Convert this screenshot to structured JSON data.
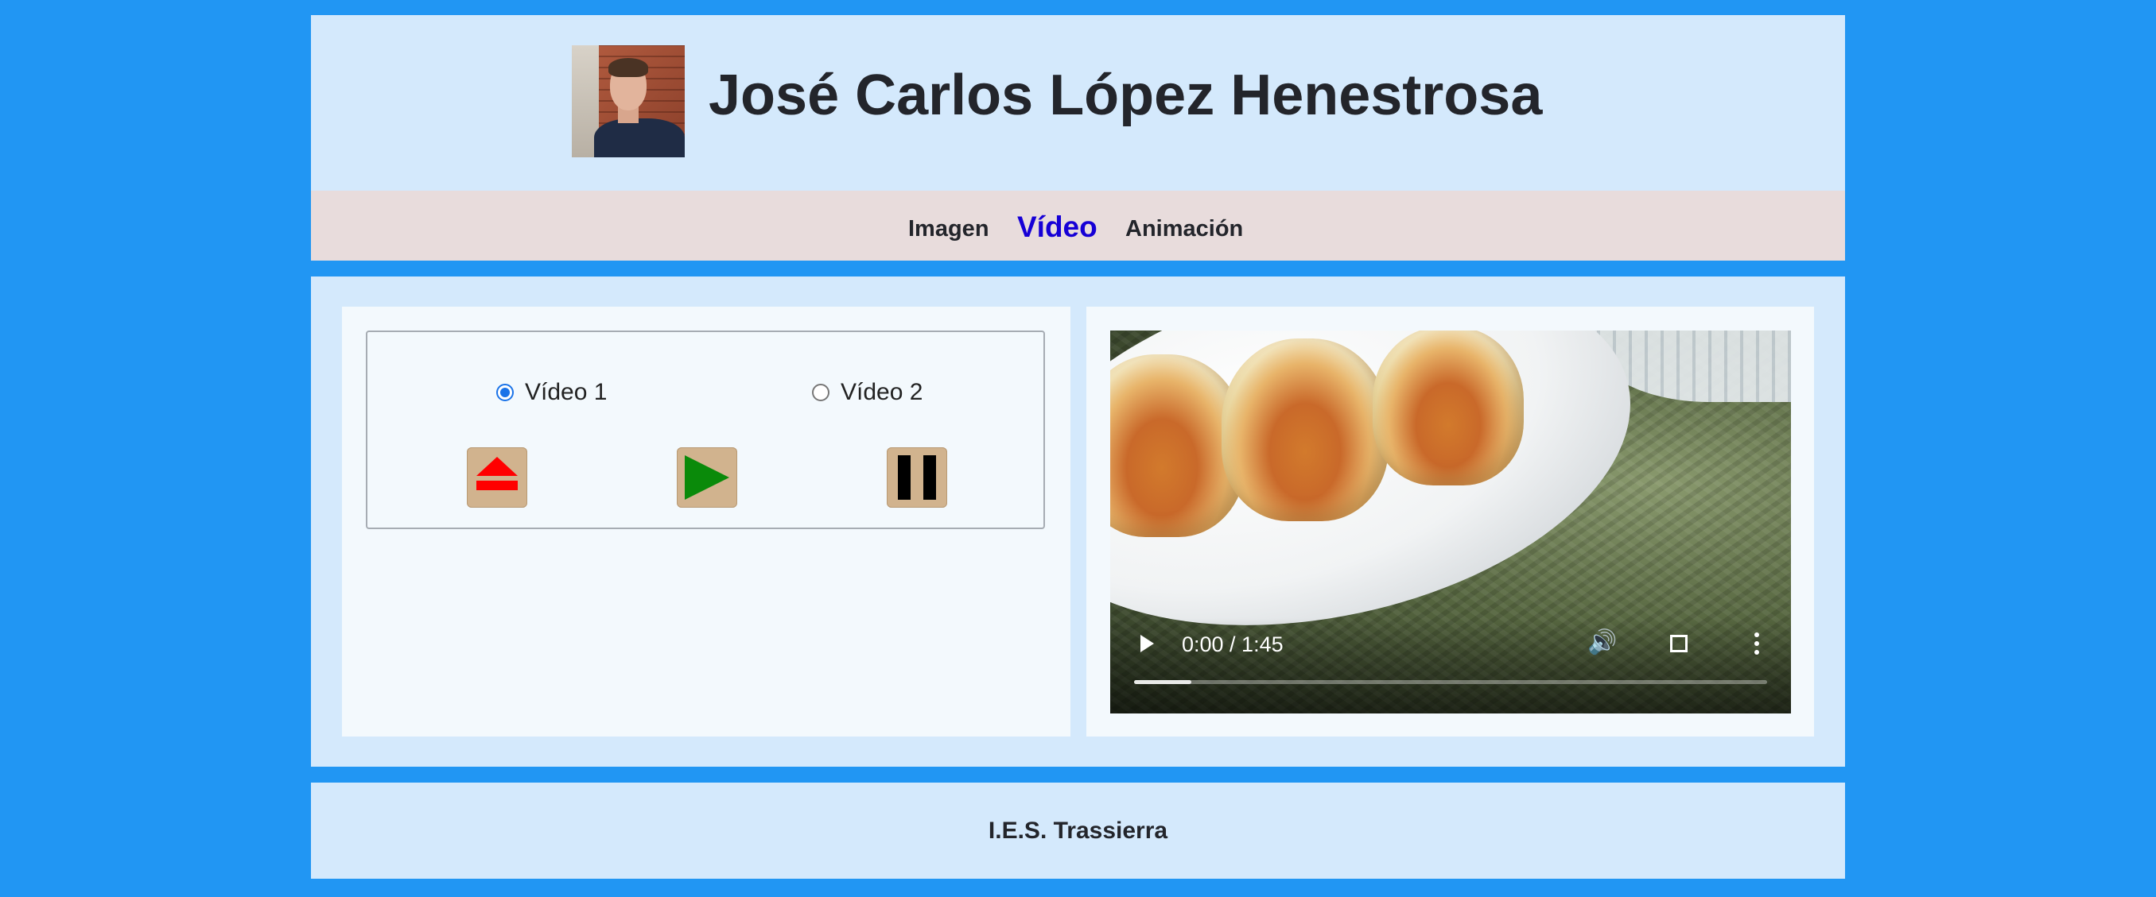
{
  "header": {
    "title": "José Carlos López Henestrosa",
    "avatar_icon": "person-photo"
  },
  "nav": {
    "items": [
      {
        "label": "Imagen"
      },
      {
        "label": "Vídeo",
        "active": true
      },
      {
        "label": "Animación"
      }
    ],
    "active_color": "#1600d6"
  },
  "controls": {
    "radios": [
      {
        "label": "Vídeo 1",
        "checked": true
      },
      {
        "label": "Vídeo 2",
        "checked": false
      }
    ],
    "buttons": [
      {
        "icon": "eject-icon"
      },
      {
        "icon": "play-icon"
      },
      {
        "icon": "pause-icon"
      }
    ]
  },
  "video": {
    "time": "0:00 / 1:45",
    "progress": 0.09
  },
  "footer": {
    "text": "I.E.S. Trassierra"
  },
  "colors": {
    "page_bg": "#2196f3",
    "section_bg": "#d4e9fc",
    "nav_bg": "#e8dcdc",
    "button_bg": "#d1b38e",
    "eject": "#ff0000",
    "play": "#0a8a0a"
  }
}
